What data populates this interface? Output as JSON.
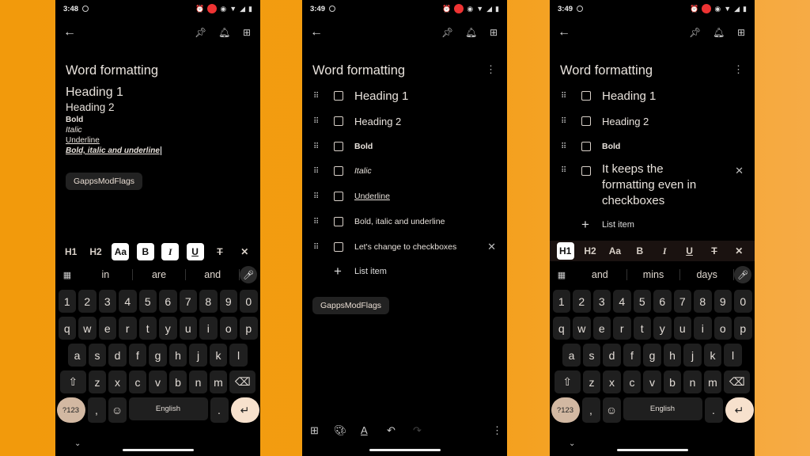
{
  "phones": [
    {
      "status": {
        "time": "3:48"
      },
      "note": {
        "title": "Word formatting",
        "lines": [
          {
            "text": "Heading 1",
            "style": "h1"
          },
          {
            "text": "Heading 2",
            "style": "h2"
          },
          {
            "text": "Bold",
            "style": "bold"
          },
          {
            "text": "Italic",
            "style": "italic"
          },
          {
            "text": "Underline",
            "style": "underline"
          },
          {
            "text": "Bold, italic and underline",
            "style": "bold-italic-underline"
          }
        ],
        "label_chip": "GappsModFlags"
      },
      "format_toolbar": {
        "h1": "H1",
        "h2": "H2",
        "normal": "Aa",
        "bold": "B",
        "italic": "I",
        "underline": "U",
        "active": [
          "Aa",
          "B",
          "I",
          "U"
        ]
      },
      "suggestions": [
        "in",
        "are",
        "and"
      ],
      "keyboard": {
        "space_label": "English",
        "sym_label": "?123"
      }
    },
    {
      "status": {
        "time": "3:49"
      },
      "note": {
        "title": "Word formatting",
        "checklist": [
          {
            "text": "Heading 1",
            "style": "h1",
            "checked": false
          },
          {
            "text": "Heading 2",
            "style": "h2",
            "checked": false
          },
          {
            "text": "Bold",
            "style": "bold",
            "checked": false
          },
          {
            "text": "Italic",
            "style": "italic",
            "checked": false
          },
          {
            "text": "Underline",
            "style": "underline",
            "checked": false
          },
          {
            "text": "Bold, italic and underline",
            "style": "normal",
            "checked": false
          },
          {
            "text": "Let's change to checkboxes",
            "style": "normal",
            "checked": false
          }
        ],
        "add_item_label": "List item",
        "label_chip": "GappsModFlags"
      }
    },
    {
      "status": {
        "time": "3:49"
      },
      "note": {
        "title": "Word formatting",
        "checklist": [
          {
            "text": "Heading 1",
            "style": "h1",
            "checked": false
          },
          {
            "text": "Heading 2",
            "style": "h2",
            "checked": false
          },
          {
            "text": "Bold",
            "style": "bold",
            "checked": false
          },
          {
            "text": "It keeps the formatting even in checkboxes",
            "style": "h1",
            "checked": false
          }
        ],
        "add_item_label": "List item"
      },
      "format_toolbar": {
        "h1": "H1",
        "h2": "H2",
        "normal": "Aa",
        "bold": "B",
        "italic": "I",
        "underline": "U",
        "active": [
          "H1"
        ]
      },
      "suggestions": [
        "and",
        "mins",
        "days"
      ],
      "keyboard": {
        "space_label": "English",
        "sym_label": "?123"
      }
    }
  ],
  "keyboard_rows": {
    "numbers": [
      "1",
      "2",
      "3",
      "4",
      "5",
      "6",
      "7",
      "8",
      "9",
      "0"
    ],
    "row1": [
      "q",
      "w",
      "e",
      "r",
      "t",
      "y",
      "u",
      "i",
      "o",
      "p"
    ],
    "row2": [
      "a",
      "s",
      "d",
      "f",
      "g",
      "h",
      "j",
      "k",
      "l"
    ],
    "row3": [
      "z",
      "x",
      "c",
      "v",
      "b",
      "n",
      "m"
    ]
  },
  "colors": {
    "background": "#f29a0c",
    "phone": "#000000",
    "key": "#1f1f1f",
    "sym_key": "#d2b8a2",
    "enter_key": "#f7e1cd",
    "record_dot": "#e33333"
  }
}
